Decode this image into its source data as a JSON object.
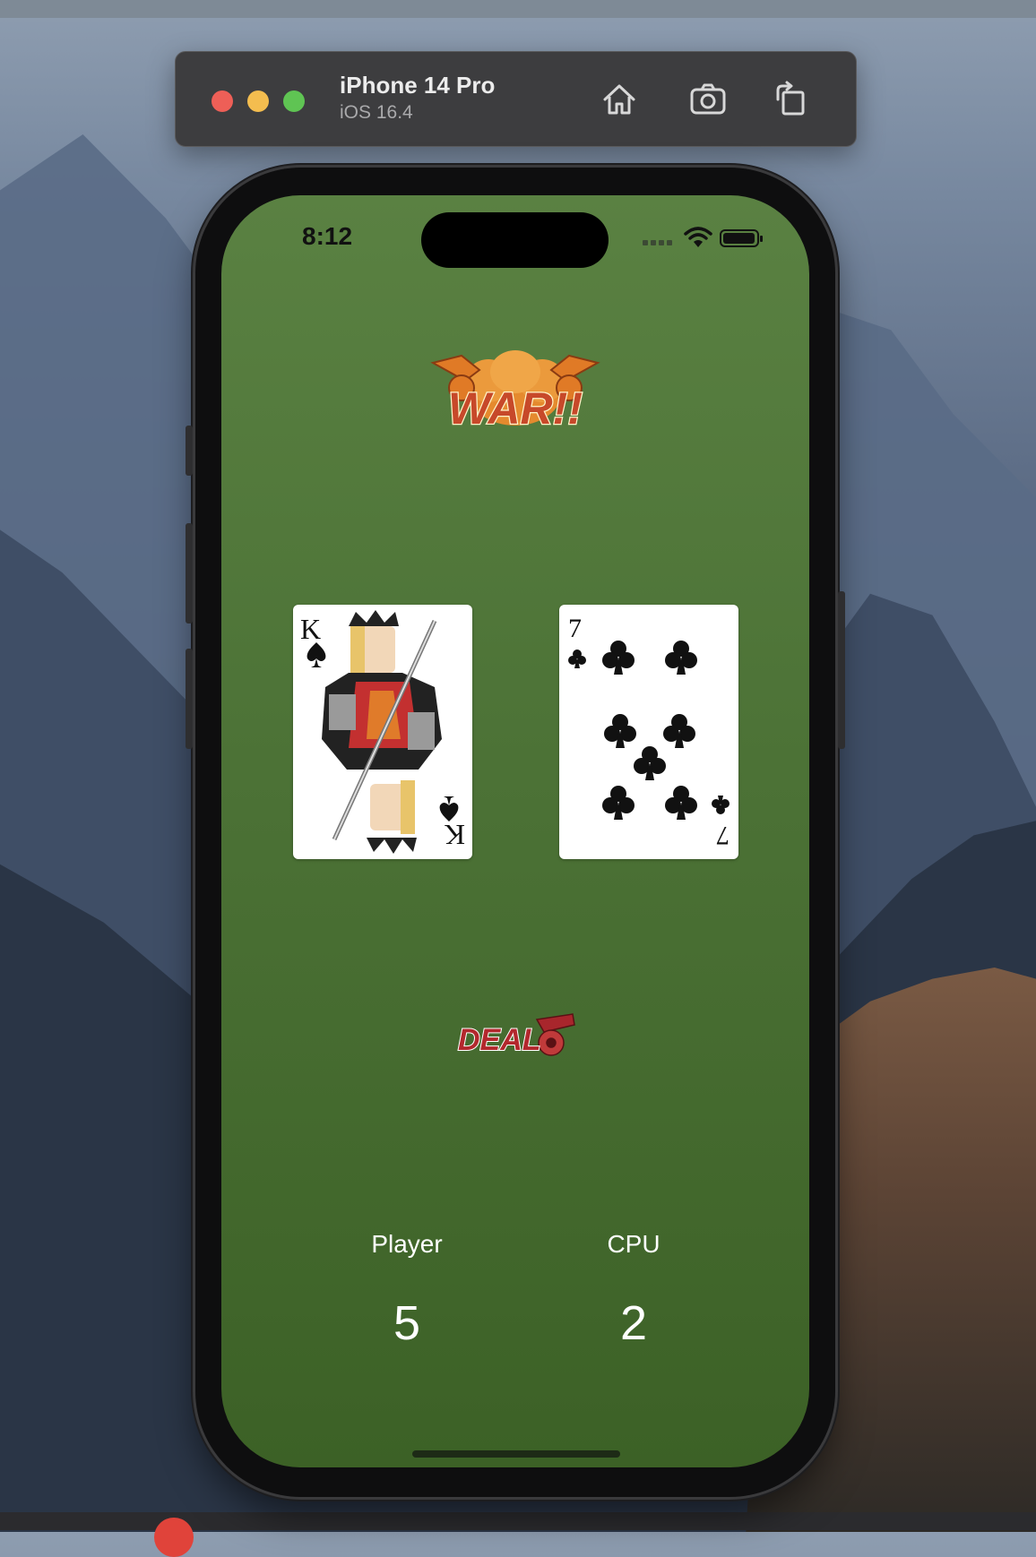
{
  "simulator": {
    "device_name": "iPhone 14 Pro",
    "os_version": "iOS 16.4",
    "toolbar_icons": [
      "home-icon",
      "screenshot-icon",
      "rotate-icon"
    ]
  },
  "status_bar": {
    "time": "8:12"
  },
  "game": {
    "logo_text": "WAR!!",
    "player_card": {
      "rank": "K",
      "suit": "spades"
    },
    "cpu_card": {
      "rank": "7",
      "suit": "clubs"
    },
    "deal_button_text": "DEAL",
    "scores": [
      {
        "label": "Player",
        "value": "5"
      },
      {
        "label": "CPU",
        "value": "2"
      }
    ]
  },
  "colors": {
    "felt_top": "#5a8142",
    "felt_bottom": "#3c6126",
    "logo_orange": "#e0782a",
    "deal_red": "#b3282d"
  }
}
